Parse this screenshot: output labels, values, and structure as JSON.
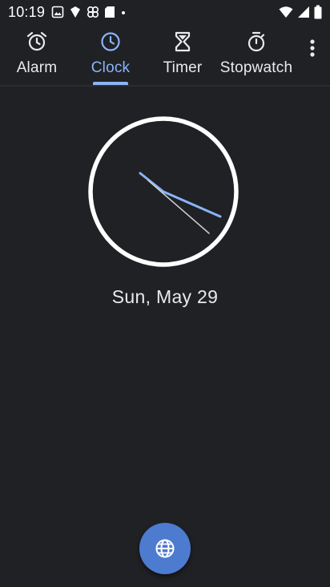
{
  "status_bar": {
    "time": "10:19",
    "notification_icons": [
      "photos-icon",
      "shield-icon",
      "pinwheel-icon",
      "sd-card-icon",
      "dot-icon"
    ],
    "system_icons": [
      "wifi-icon",
      "cellular-signal-icon",
      "battery-icon"
    ]
  },
  "nav": {
    "tabs": [
      {
        "label": "Alarm",
        "icon": "alarm-clock-icon",
        "active": false
      },
      {
        "label": "Clock",
        "icon": "clock-icon",
        "active": true
      },
      {
        "label": "Timer",
        "icon": "hourglass-icon",
        "active": false
      },
      {
        "label": "Stopwatch",
        "icon": "stopwatch-icon",
        "active": false
      }
    ],
    "overflow_icon": "more-vert-icon"
  },
  "clock": {
    "time_shown": "10:19",
    "date": "Sun, May 29"
  },
  "fab": {
    "icon": "globe-icon"
  },
  "colors": {
    "background": "#202124",
    "accent": "#8ab4f8",
    "text": "#e8eaed",
    "fab": "#4c7bd0"
  }
}
